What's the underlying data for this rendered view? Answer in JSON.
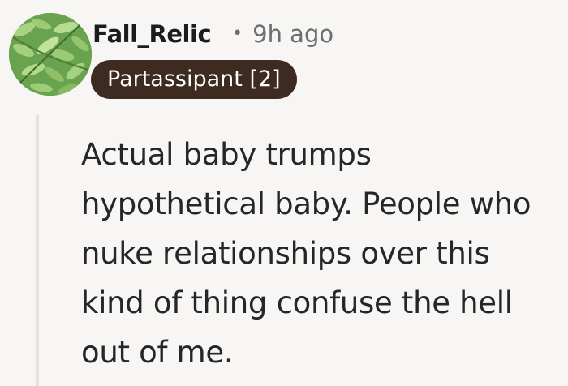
{
  "comment": {
    "username": "Fall_Relic",
    "separator": "•",
    "timestamp": "9h ago",
    "flair": "Partassipant [2]",
    "body": "Actual baby trumps hypothetical baby. People who nuke relationships over this kind of thing confuse the hell out of me."
  },
  "colors": {
    "background": "#f7f6f4",
    "flair_background": "#3d2a21",
    "flair_text": "#ffffff",
    "username": "#1c1c1c",
    "meta_text": "#6e6e6e",
    "body_text": "#262626",
    "thread_line": "#e6e3de"
  },
  "icons": {
    "avatar": "green-fern-avatar"
  }
}
